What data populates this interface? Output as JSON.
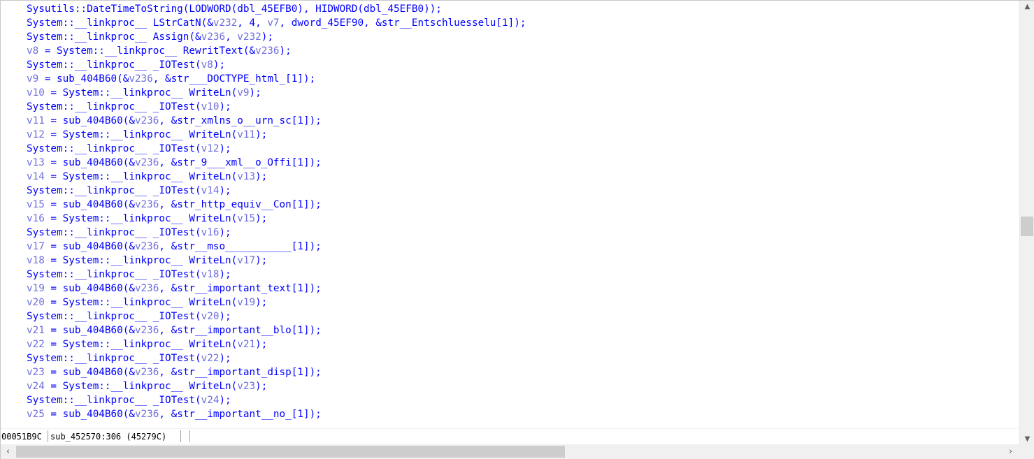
{
  "code_lines": [
    [
      {
        "t": "Sysutils::DateTimeToString(LODWORD(dbl_45EFB0), HIDWORD(dbl_45EFB0));"
      }
    ],
    [
      {
        "t": "System::__linkproc__ LStrCatN(&"
      },
      {
        "t": "v232",
        "v": true
      },
      {
        "t": ", 4, "
      },
      {
        "t": "v7",
        "v": true
      },
      {
        "t": ", dword_45EF90, &str__Entschluesselu[1]);"
      }
    ],
    [
      {
        "t": "System::__linkproc__ Assign(&"
      },
      {
        "t": "v236",
        "v": true
      },
      {
        "t": ", "
      },
      {
        "t": "v232",
        "v": true
      },
      {
        "t": ");"
      }
    ],
    [
      {
        "t": "v8",
        "v": true
      },
      {
        "t": " = System::__linkproc__ RewritText(&"
      },
      {
        "t": "v236",
        "v": true
      },
      {
        "t": ");"
      }
    ],
    [
      {
        "t": "System::__linkproc__ _IOTest("
      },
      {
        "t": "v8",
        "v": true
      },
      {
        "t": ");"
      }
    ],
    [
      {
        "t": "v9",
        "v": true
      },
      {
        "t": " = sub_404B60(&"
      },
      {
        "t": "v236",
        "v": true
      },
      {
        "t": ", &str___DOCTYPE_html_[1]);"
      }
    ],
    [
      {
        "t": "v10",
        "v": true
      },
      {
        "t": " = System::__linkproc__ WriteLn("
      },
      {
        "t": "v9",
        "v": true
      },
      {
        "t": ");"
      }
    ],
    [
      {
        "t": "System::__linkproc__ _IOTest("
      },
      {
        "t": "v10",
        "v": true
      },
      {
        "t": ");"
      }
    ],
    [
      {
        "t": "v11",
        "v": true
      },
      {
        "t": " = sub_404B60(&"
      },
      {
        "t": "v236",
        "v": true
      },
      {
        "t": ", &str_xmlns_o__urn_sc[1]);"
      }
    ],
    [
      {
        "t": "v12",
        "v": true
      },
      {
        "t": " = System::__linkproc__ WriteLn("
      },
      {
        "t": "v11",
        "v": true
      },
      {
        "t": ");"
      }
    ],
    [
      {
        "t": "System::__linkproc__ _IOTest("
      },
      {
        "t": "v12",
        "v": true
      },
      {
        "t": ");"
      }
    ],
    [
      {
        "t": "v13",
        "v": true
      },
      {
        "t": " = sub_404B60(&"
      },
      {
        "t": "v236",
        "v": true
      },
      {
        "t": ", &str_9___xml__o_Offi[1]);"
      }
    ],
    [
      {
        "t": "v14",
        "v": true
      },
      {
        "t": " = System::__linkproc__ WriteLn("
      },
      {
        "t": "v13",
        "v": true
      },
      {
        "t": ");"
      }
    ],
    [
      {
        "t": "System::__linkproc__ _IOTest("
      },
      {
        "t": "v14",
        "v": true
      },
      {
        "t": ");"
      }
    ],
    [
      {
        "t": "v15",
        "v": true
      },
      {
        "t": " = sub_404B60(&"
      },
      {
        "t": "v236",
        "v": true
      },
      {
        "t": ", &str_http_equiv__Con[1]);"
      }
    ],
    [
      {
        "t": "v16",
        "v": true
      },
      {
        "t": " = System::__linkproc__ WriteLn("
      },
      {
        "t": "v15",
        "v": true
      },
      {
        "t": ");"
      }
    ],
    [
      {
        "t": "System::__linkproc__ _IOTest("
      },
      {
        "t": "v16",
        "v": true
      },
      {
        "t": ");"
      }
    ],
    [
      {
        "t": "v17",
        "v": true
      },
      {
        "t": " = sub_404B60(&"
      },
      {
        "t": "v236",
        "v": true
      },
      {
        "t": ", &str__mso___________[1]);"
      }
    ],
    [
      {
        "t": "v18",
        "v": true
      },
      {
        "t": " = System::__linkproc__ WriteLn("
      },
      {
        "t": "v17",
        "v": true
      },
      {
        "t": ");"
      }
    ],
    [
      {
        "t": "System::__linkproc__ _IOTest("
      },
      {
        "t": "v18",
        "v": true
      },
      {
        "t": ");"
      }
    ],
    [
      {
        "t": "v19",
        "v": true
      },
      {
        "t": " = sub_404B60(&"
      },
      {
        "t": "v236",
        "v": true
      },
      {
        "t": ", &str__important_text[1]);"
      }
    ],
    [
      {
        "t": "v20",
        "v": true
      },
      {
        "t": " = System::__linkproc__ WriteLn("
      },
      {
        "t": "v19",
        "v": true
      },
      {
        "t": ");"
      }
    ],
    [
      {
        "t": "System::__linkproc__ _IOTest("
      },
      {
        "t": "v20",
        "v": true
      },
      {
        "t": ");"
      }
    ],
    [
      {
        "t": "v21",
        "v": true
      },
      {
        "t": " = sub_404B60(&"
      },
      {
        "t": "v236",
        "v": true
      },
      {
        "t": ", &str__important__blo[1]);"
      }
    ],
    [
      {
        "t": "v22",
        "v": true
      },
      {
        "t": " = System::__linkproc__ WriteLn("
      },
      {
        "t": "v21",
        "v": true
      },
      {
        "t": ");"
      }
    ],
    [
      {
        "t": "System::__linkproc__ _IOTest("
      },
      {
        "t": "v22",
        "v": true
      },
      {
        "t": ");"
      }
    ],
    [
      {
        "t": "v23",
        "v": true
      },
      {
        "t": " = sub_404B60(&"
      },
      {
        "t": "v236",
        "v": true
      },
      {
        "t": ", &str__important_disp[1]);"
      }
    ],
    [
      {
        "t": "v24",
        "v": true
      },
      {
        "t": " = System::__linkproc__ WriteLn("
      },
      {
        "t": "v23",
        "v": true
      },
      {
        "t": ");"
      }
    ],
    [
      {
        "t": "System::__linkproc__ _IOTest("
      },
      {
        "t": "v24",
        "v": true
      },
      {
        "t": ");"
      }
    ],
    [
      {
        "t": "v25",
        "v": true
      },
      {
        "t": " = sub_404B60(&"
      },
      {
        "t": "v236",
        "v": true
      },
      {
        "t": ", &str__important__no_[1]);"
      }
    ]
  ],
  "statusbar": {
    "address": "00051B9C",
    "location": "sub_452570:306 (45279C)"
  },
  "colors": {
    "code_text": "#0000ff",
    "variable_text": "#6f6fdd",
    "background": "#ffffff",
    "scrollbar_track": "#f0f0f0",
    "scrollbar_thumb": "#cdcdcd"
  },
  "icons": {
    "vscroll_up": "chevron-up-icon",
    "vscroll_down": "chevron-down-icon",
    "hscroll_left": "chevron-left-icon",
    "hscroll_right": "chevron-right-icon"
  }
}
